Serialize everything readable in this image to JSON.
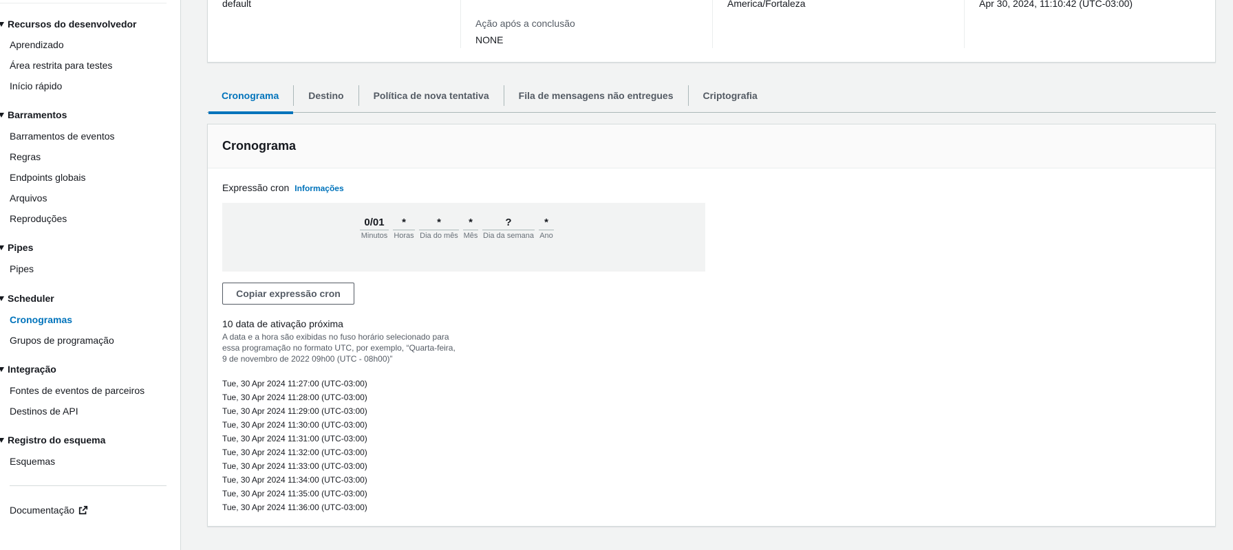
{
  "sidebar": {
    "sections": [
      {
        "title": "Recursos do desenvolvedor",
        "items": [
          "Aprendizado",
          "Área restrita para testes",
          "Início rápido"
        ]
      },
      {
        "title": "Barramentos",
        "items": [
          "Barramentos de eventos",
          "Regras",
          "Endpoints globais",
          "Arquivos",
          "Reproduções"
        ]
      },
      {
        "title": "Pipes",
        "items": [
          "Pipes"
        ]
      },
      {
        "title": "Scheduler",
        "items": [
          "Cronogramas",
          "Grupos de programação"
        ]
      },
      {
        "title": "Integração",
        "items": [
          "Fontes de eventos de parceiros",
          "Destinos de API"
        ]
      },
      {
        "title": "Registro do esquema",
        "items": [
          "Esquemas"
        ]
      }
    ],
    "active_item": "Cronogramas",
    "documentation_label": "Documentação"
  },
  "summary": {
    "col1_value": "default",
    "col2_label": "Ação após a conclusão",
    "col2_value": "NONE",
    "col3_value": "America/Fortaleza",
    "col4_value": "Apr 30, 2024, 11:10:42 (UTC-03:00)"
  },
  "tabs": [
    {
      "label": "Cronograma",
      "active": true
    },
    {
      "label": "Destino",
      "active": false
    },
    {
      "label": "Política de nova tentativa",
      "active": false
    },
    {
      "label": "Fila de mensagens não entregues",
      "active": false
    },
    {
      "label": "Criptografia",
      "active": false
    }
  ],
  "schedule": {
    "title": "Cronograma",
    "cron_label": "Expressão cron",
    "info_link": "Informações",
    "cron_fields": [
      {
        "value": "0/01",
        "unit": "Minutos"
      },
      {
        "value": "*",
        "unit": "Horas"
      },
      {
        "value": "*",
        "unit": "Dia do mês"
      },
      {
        "value": "*",
        "unit": "Mês"
      },
      {
        "value": "?",
        "unit": "Dia da semana"
      },
      {
        "value": "*",
        "unit": "Ano"
      }
    ],
    "copy_button": "Copiar expressão cron",
    "next_title": "10 data de ativação próxima",
    "next_description": "A data e a hora são exibidas no fuso horário selecionado para essa programação no formato UTC, por exemplo, “Quarta-feira, 9 de novembro de 2022 09h00 (UTC - 08h00)”",
    "dates": [
      "Tue, 30 Apr 2024 11:27:00 (UTC-03:00)",
      "Tue, 30 Apr 2024 11:28:00 (UTC-03:00)",
      "Tue, 30 Apr 2024 11:29:00 (UTC-03:00)",
      "Tue, 30 Apr 2024 11:30:00 (UTC-03:00)",
      "Tue, 30 Apr 2024 11:31:00 (UTC-03:00)",
      "Tue, 30 Apr 2024 11:32:00 (UTC-03:00)",
      "Tue, 30 Apr 2024 11:33:00 (UTC-03:00)",
      "Tue, 30 Apr 2024 11:34:00 (UTC-03:00)",
      "Tue, 30 Apr 2024 11:35:00 (UTC-03:00)",
      "Tue, 30 Apr 2024 11:36:00 (UTC-03:00)"
    ]
  },
  "colors": {
    "accent": "#0073bb",
    "text": "#16191f",
    "muted": "#545b64",
    "background": "#f2f3f3"
  }
}
